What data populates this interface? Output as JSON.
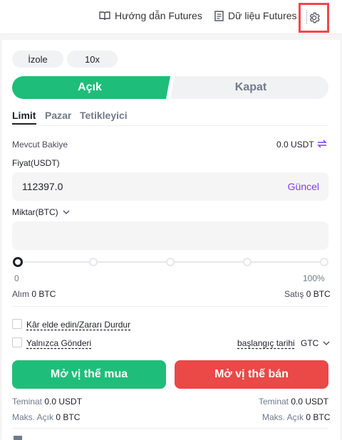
{
  "header": {
    "guide_label": "Hướng dẫn Futures",
    "data_label": "Dữ liệu Futures"
  },
  "mode": {
    "margin_mode": "İzole",
    "leverage": "10x"
  },
  "side": {
    "open": "Açık",
    "close": "Kapat"
  },
  "order_tabs": {
    "limit": "Limit",
    "market": "Pazar",
    "trigger": "Tetikleyici"
  },
  "balance": {
    "label": "Mevcut Bakiye",
    "value": "0.0 USDT"
  },
  "price": {
    "label": "Fiyat(USDT)",
    "value": "112397.0",
    "latest": "Güncel"
  },
  "quantity": {
    "label": "Miktar(BTC)",
    "value": ""
  },
  "slider": {
    "min_label": "0",
    "max_label": "100%",
    "level_fraction": 0
  },
  "amounts": {
    "buy_label": "Alım",
    "buy_value": "0 BTC",
    "sell_label": "Satış",
    "sell_value": "0 BTC"
  },
  "options": {
    "tpsl": "Kâr elde edin/Zararı Durdur",
    "reduce_only": "Yalnızca Gönderi",
    "tif_label": "başlangıç tarihi",
    "tif_value": "GTC"
  },
  "actions": {
    "buy": "Mở vị thế mua",
    "sell": "Mở vị thế bán"
  },
  "summary": {
    "margin_label": "Teminat",
    "margin_buy": "0.0 USDT",
    "margin_sell": "0.0 USDT",
    "max_label": "Maks. Açık",
    "max_buy": "0 BTC",
    "max_sell": "0 BTC"
  },
  "colors": {
    "buy": "#1fbd7a",
    "sell": "#eb4848",
    "accent": "#7b40f2",
    "highlight": "#f0474c"
  }
}
